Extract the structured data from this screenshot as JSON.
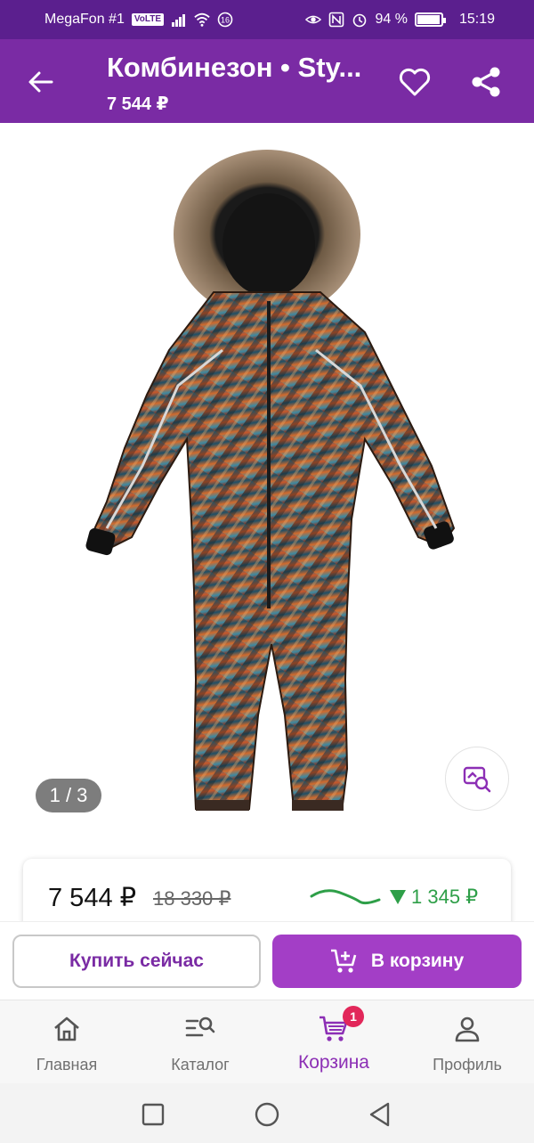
{
  "status_bar": {
    "carrier": "MegaFon #1",
    "volte": "VoLTE",
    "battery": "94 %",
    "time": "15:19"
  },
  "header": {
    "title": "Комбинезон • Sty...",
    "price": "7 544 ₽",
    "icons": {
      "back": "back-arrow-icon",
      "favorite": "heart-icon",
      "share": "share-icon"
    }
  },
  "gallery": {
    "counter": "1 / 3",
    "visual_search_icon": "visual-search-icon"
  },
  "price_card": {
    "current_price": "7 544 ₽",
    "old_price": "18 330 ₽",
    "discount": "1 345 ₽",
    "discount_color": "#2e9f48"
  },
  "actions": {
    "buy_now_label": "Купить сейчас",
    "add_to_cart_label": "В корзину"
  },
  "bottom_nav": {
    "items": [
      {
        "label": "Главная",
        "icon": "home-icon"
      },
      {
        "label": "Каталог",
        "icon": "catalog-search-icon"
      },
      {
        "label": "Корзина",
        "icon": "cart-icon",
        "badge": "1",
        "active": true
      },
      {
        "label": "Профиль",
        "icon": "profile-icon"
      }
    ]
  },
  "colors": {
    "status_bar": "#5b1f8e",
    "header": "#7a2ba4",
    "accent": "#a33ec6",
    "badge": "#e2275a"
  }
}
